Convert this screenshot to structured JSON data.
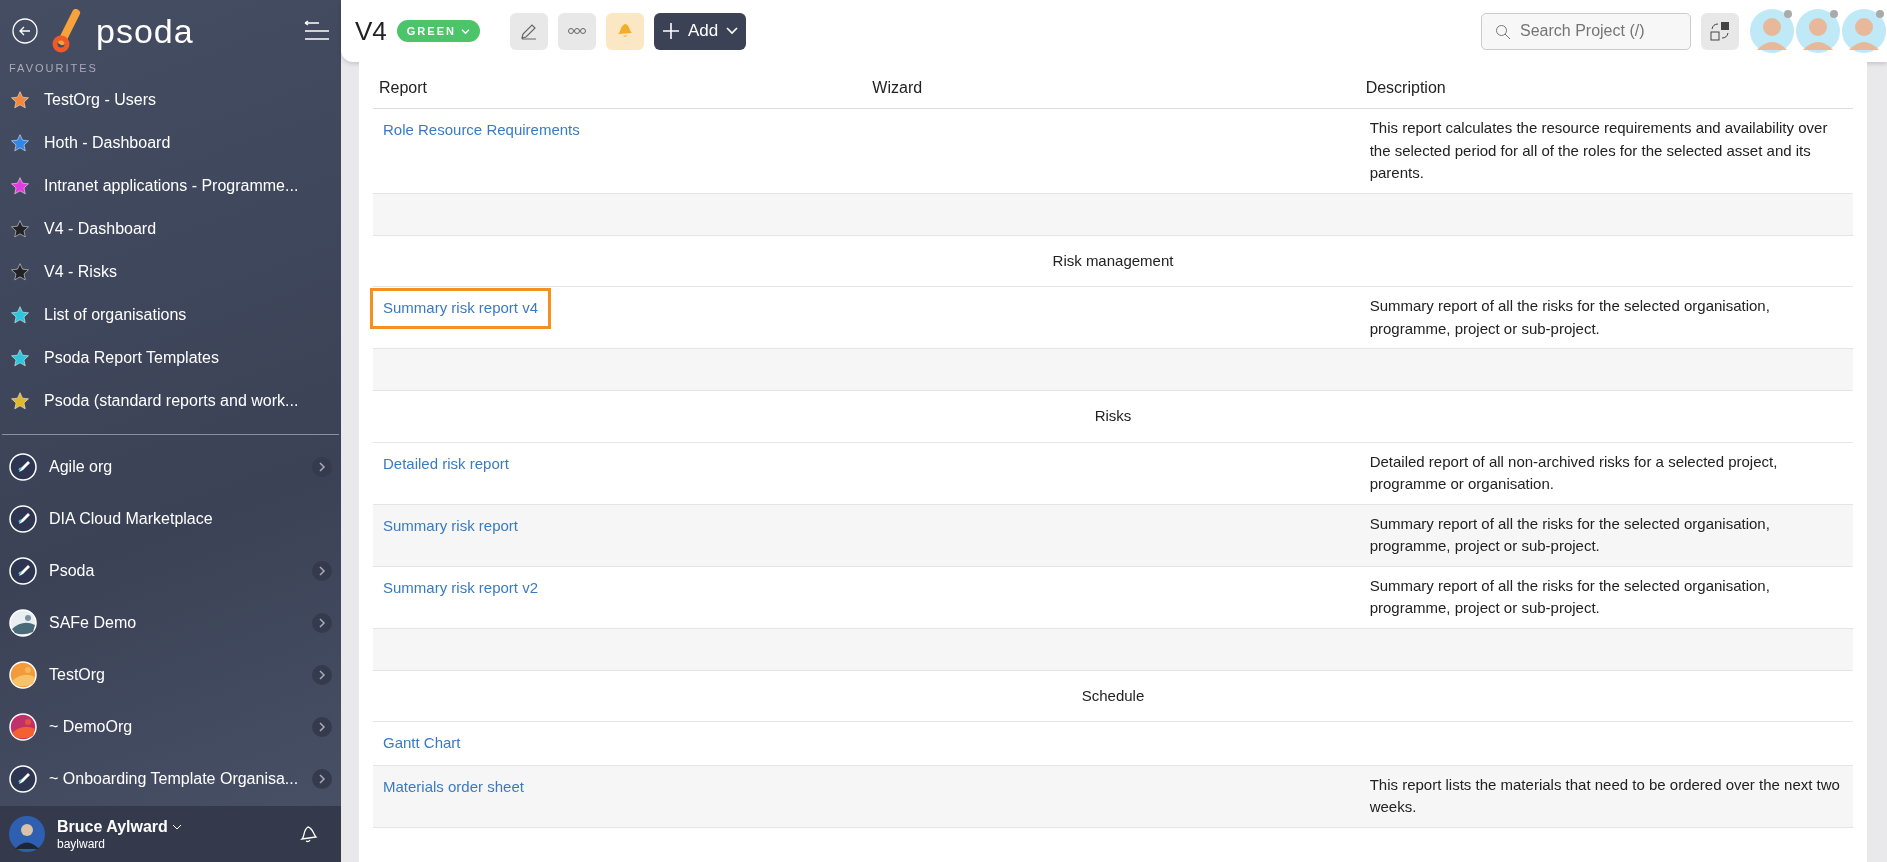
{
  "sidebar": {
    "brand": "psoda",
    "favourites_label": "FAVOURITES",
    "favourites": [
      {
        "label": "TestOrg - Users",
        "color": "#f5873a"
      },
      {
        "label": "Hoth - Dashboard",
        "color": "#2f86e6"
      },
      {
        "label": "Intranet applications - Programme...",
        "color": "#e23be0"
      },
      {
        "label": "V4 - Dashboard",
        "color": "#222222"
      },
      {
        "label": "V4 - Risks",
        "color": "#222222"
      },
      {
        "label": "List of organisations",
        "color": "#2ec6dc"
      },
      {
        "label": "Psoda Report Templates",
        "color": "#2ec6dc"
      },
      {
        "label": "Psoda (standard reports and work...",
        "color": "#e0b82a"
      }
    ],
    "organisations": [
      {
        "label": "Agile org",
        "kind": "rocket",
        "expandable": true
      },
      {
        "label": "DIA Cloud Marketplace",
        "kind": "rocket",
        "expandable": false
      },
      {
        "label": "Psoda",
        "kind": "rocket",
        "expandable": true
      },
      {
        "label": "SAFe Demo",
        "kind": "picture",
        "expandable": true
      },
      {
        "label": "TestOrg",
        "kind": "picture",
        "expandable": true
      },
      {
        "label": "~ DemoOrg",
        "kind": "picture",
        "expandable": true
      },
      {
        "label": "~ Onboarding Template Organisa...",
        "kind": "rocket",
        "expandable": true
      }
    ],
    "user": {
      "name": "Bruce Aylward",
      "username": "baylward"
    }
  },
  "header": {
    "title": "V4",
    "status": "GREEN",
    "add_label": "Add",
    "search": {
      "placeholder": "Search Project (/)"
    },
    "avatars": [
      {
        "kind": "person"
      },
      {
        "kind": "person"
      },
      {
        "kind": "person"
      }
    ]
  },
  "table": {
    "columns": [
      "Report",
      "Wizard",
      "Description"
    ],
    "rows": [
      {
        "kind": "report",
        "report": "Role Resource Requirements",
        "description": "This report calculates the resource requirements and availability over the selected period for all of the roles for the selected asset and its parents.",
        "highlighted": false
      },
      {
        "kind": "spacer"
      },
      {
        "kind": "section",
        "title": "Risk management"
      },
      {
        "kind": "report",
        "report": "Summary risk report v4",
        "description": "Summary report of all the risks for the selected organisation, programme, project or sub-project.",
        "highlighted": true
      },
      {
        "kind": "spacer"
      },
      {
        "kind": "section",
        "title": "Risks"
      },
      {
        "kind": "report",
        "report": "Detailed risk report",
        "description": "Detailed report of all non-archived risks for a selected project, programme or organisation.",
        "highlighted": false
      },
      {
        "kind": "report",
        "report": "Summary risk report",
        "description": "Summary report of all the risks for the selected organisation, programme, project or sub-project.",
        "highlighted": false
      },
      {
        "kind": "report",
        "report": "Summary risk report v2",
        "description": "Summary report of all the risks for the selected organisation, programme, project or sub-project.",
        "highlighted": false
      },
      {
        "kind": "spacer"
      },
      {
        "kind": "section",
        "title": "Schedule"
      },
      {
        "kind": "report",
        "report": "Gantt Chart",
        "highlighted": false
      },
      {
        "kind": "report",
        "report": "Materials order sheet",
        "description": "This report lists the materials that need to be ordered over the next two weeks.",
        "highlighted": false
      }
    ]
  }
}
